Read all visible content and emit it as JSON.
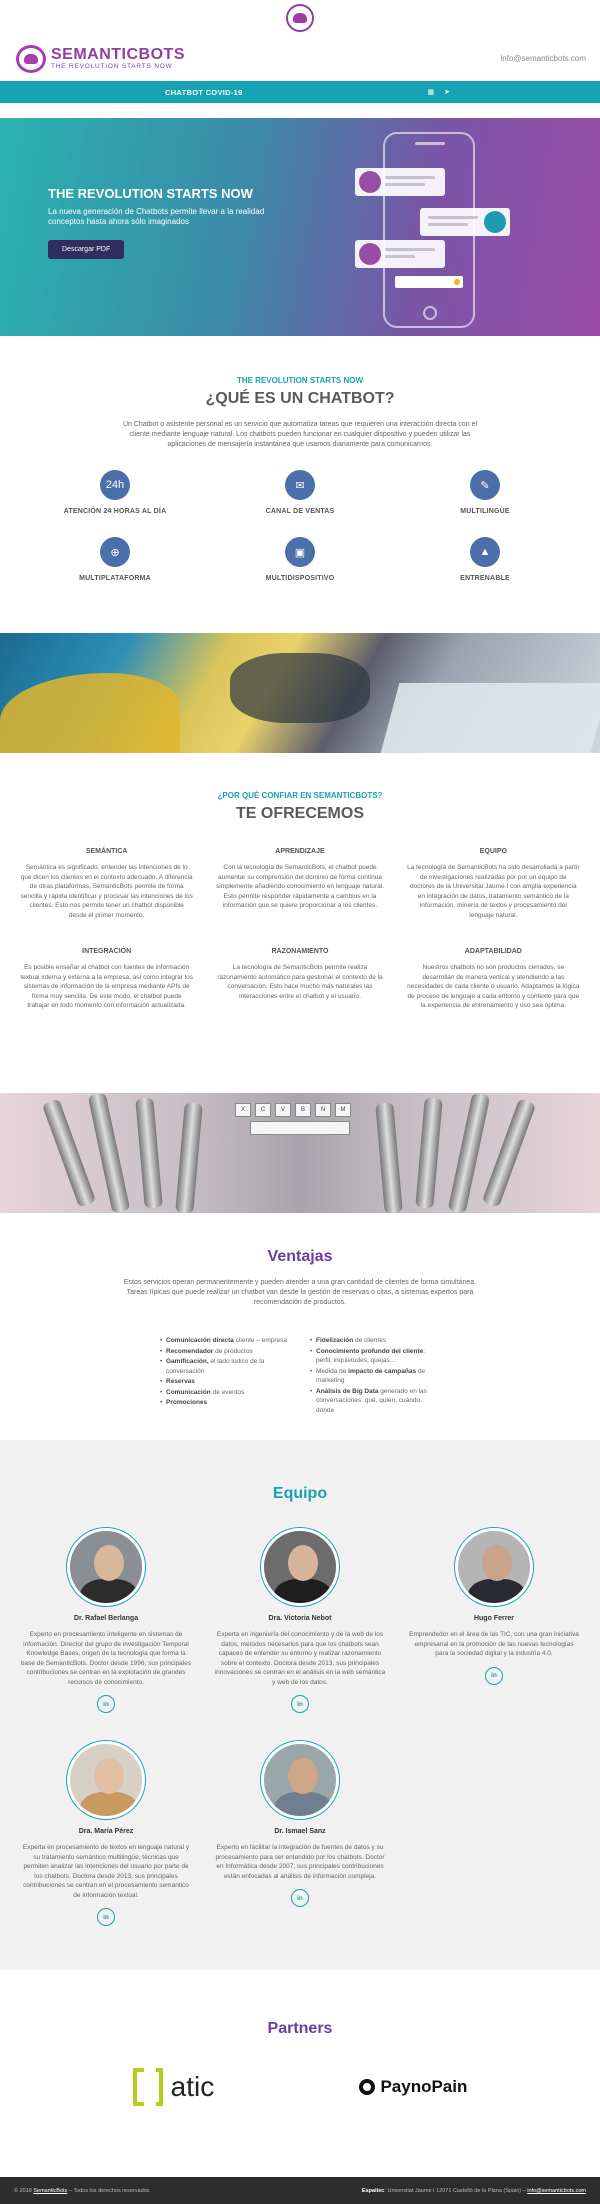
{
  "brand": {
    "name": "SEMANTICBOTS",
    "tagline": "THE REVOLUTION STARTS NOW",
    "email": "info@semanticbots.com"
  },
  "nav": {
    "items": [
      "CHATBOT COVID-19"
    ]
  },
  "hero": {
    "title": "THE REVOLUTION STARTS NOW",
    "subtitle": "La nueva generación de Chatbots permite llevar a la realidad conceptos hasta ahora sólo imaginados",
    "button": "Descargar PDF"
  },
  "what": {
    "kicker": "THE REVOLUTION STARTS NOW",
    "title": "¿QUÉ ES UN CHATBOT?",
    "description": "Un Chatbot o asistente personal es un servicio que automatiza tareas que requieren una interacción directa con el cliente mediante lenguaje natural. Los chatbots pueden funcionar en cualquier dispositivo y pueden utilizar las aplicaciones de mensajería instantánea que usamos diariamente para comunicarnos.",
    "features": [
      {
        "label": "ATENCIÓN 24 HORAS AL DÍA",
        "icon": "clock-24h-icon",
        "glyph": "24h"
      },
      {
        "label": "CANAL DE VENTAS",
        "icon": "megaphone-icon",
        "glyph": "✉"
      },
      {
        "label": "MULTILINGÜE",
        "icon": "speech-bubbles-icon",
        "glyph": "✎"
      },
      {
        "label": "MULTIPLATAFORMA",
        "icon": "globe-icon",
        "glyph": "⊕"
      },
      {
        "label": "MULTIDISPOSITIVO",
        "icon": "devices-icon",
        "glyph": "▣"
      },
      {
        "label": "ENTRENABLE",
        "icon": "graduation-cap-icon",
        "glyph": "▲"
      }
    ]
  },
  "why": {
    "kicker": "¿POR QUÉ CONFIAR EN SEMANTICBOTS?",
    "title": "TE OFRECEMOS",
    "items": [
      {
        "title": "SEMÁNTICA",
        "text": "Semántica es significado, entender las intenciones de lo que dicen los clientes en el contexto adecuado. A diferencia de otras plataformas, SemanticBots permite de forma sencilla y rápida identificar y procesar las intenciones de los clientes. Esto nos permite tener un chatbot disponible desde el primer momento."
      },
      {
        "title": "APRENDIZAJE",
        "text": "Con la tecnología de SemanticBots, el chatbot puede aumentar su comprensión del dominio de forma continua simplemente añadiendo conocimiento en lenguaje natural. Esto permite responder rápidamente a cambios en la información que se quiere proporcionar a los clientes."
      },
      {
        "title": "EQUIPO",
        "text": "La tecnología de SemanticBots ha sido desarrollada a partir de investigaciones realizadas por por un equipo de doctores de la Universitat Jaume I con amplia experiencia en integración de datos, tratamiento semántico de la información, minería de textos y procesamiento del lenguaje natural."
      },
      {
        "title": "INTEGRACIÓN",
        "text": "Es posible enseñar al chatbot con fuentes de información textual interna y externa a la empresa, así como integrar los sistemas de información de la empresa mediante APIs de forma muy sencilla. De este modo, el chatbot puede trabajar en todo momento con información actualizada."
      },
      {
        "title": "RAZONAMIENTO",
        "text": "La tecnología de SemanticBots permite realiza razonamiento automático para gestionar el contexto de la conversación. Esto hace mucho más naturales las interacciones entre el chatbot y el usuario."
      },
      {
        "title": "ADAPTABILIDAD",
        "text": "Nuestros chatbots no son productos cerrados, se desarrollan de manera vertical y atendiendo a las necesidades de cada cliente o usuario. Adaptamos la lógica de proceso de lenguaje a cada entorno y contexto para que la experiencia de entrenamiento y uso sea óptima."
      }
    ]
  },
  "ventajas": {
    "title": "Ventajas",
    "description": "Estos servicios operan permanentemente y pueden atender a una gran cantidad de clientes de forma simultánea. Tareas típicas que puede realizar un chatbot van desde la gestión de reservas o citas, a sistemas expertos para recomendación de productos.",
    "left": [
      {
        "b": "Comunicación directa",
        "t": " cliente – empresa"
      },
      {
        "b": "Recomendador",
        "t": " de productos"
      },
      {
        "b": "Gamificación,",
        "t": " el lado lúdico de la conversación"
      },
      {
        "b": "Reservas",
        "t": ""
      },
      {
        "b": "Comunicación",
        "t": " de eventos"
      },
      {
        "b": "Promociones",
        "t": ""
      }
    ],
    "right": [
      {
        "b": "Fidelización",
        "t": " de clientes"
      },
      {
        "b": "Conocimiento profundo del cliente",
        "t": ": perfil, inquietudes, quejas…"
      },
      {
        "b": "",
        "t": "Medida de ",
        "b2": "impacto de campañas",
        "t2": " de marketing"
      },
      {
        "b": "Análisis de Big Data",
        "t": " generado en las conversaciones: qué, quién, cuándo, dónde"
      }
    ]
  },
  "team": {
    "title": "Equipo",
    "members": [
      {
        "name": "Dr. Rafael Berlanga",
        "bio": "Experto en procesamiento inteligente en sistemas de información. Director del grupo de investigación Temporal Knowledge Bases, origen de la tecnología que forma la base de SemanticBots. Doctor desde 1996, sus principales contribuciones se centran en la explotación de grandes recursos de conocimiento.",
        "skin": "#d9b79a",
        "cloth": "#2c2c2c",
        "bg": "#8a8f93"
      },
      {
        "name": "Dra. Victoria Nebot",
        "bio": "Experta en ingeniería del conocimiento y de la web de los datos, métodos necesarios para que los chatbots sean capaces de entender su entorno y realizar razonamiento sobre el contexto. Doctora desde 2013, sus principales innovaciones se centran en el análisis en la web semántica y web de los datos.",
        "skin": "#d8b49a",
        "cloth": "#1e1e1e",
        "bg": "#6c6c6c"
      },
      {
        "name": "Hugo Ferrer",
        "bio": "Emprendedor en el área de las TIC, con una gran iniciativa empresarial en la promoción de las nuevas tecnologías para la sociedad digital y la industria 4.0.",
        "skin": "#c9a38a",
        "cloth": "#2a2a34",
        "bg": "#b5b5b5"
      },
      {
        "name": "Dra. María Pérez",
        "bio": "Experta en procesamiento de textos en lenguaje natural y su tratamiento semántico multilingüe, técnicas que permiten analizar las intenciones del usuario por parte de los chatbots. Doctora desde 2013, sus principales contribuciones se centran en el procesamiento semántico de información textual.",
        "skin": "#e2c0a6",
        "cloth": "#c99a5f",
        "bg": "#d8d0c4"
      },
      {
        "name": "Dr. Ismael Sanz",
        "bio": "Experto en facilitar la integración de fuentes de datos y su procesamiento para ser entendido por los chatbots. Doctor en Informática desde 2007, sus principales contribuciones están enfocadas al análisis de información compleja.",
        "skin": "#cfa788",
        "cloth": "#6f7f8f",
        "bg": "#9aa7a8"
      }
    ],
    "linkedin_label": "in"
  },
  "partners": {
    "title": "Partners",
    "logos": [
      "atic",
      "PaynoPain"
    ]
  },
  "footer": {
    "copyright_prefix": "© 2018",
    "copyright_link": "SemanticBots",
    "copyright_suffix": " – Todos los derechos reservados",
    "address_label": "Espaitec",
    "address": ": Universitat Jaume I 12071 Castelló de la Plana (Spain) –",
    "email": "info@semanticbots.com"
  },
  "colors": {
    "accent": "#17a2b3",
    "purple": "#6b3fa0",
    "brand": "#8e3fa0",
    "footer_bg": "#2d2d2d"
  }
}
